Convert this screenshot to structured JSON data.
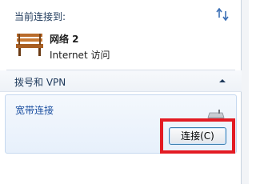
{
  "header": {
    "label": "当前连接到:"
  },
  "network": {
    "name": "网络  2",
    "status": "Internet 访问"
  },
  "group": {
    "label": "拨号和 VPN"
  },
  "connection": {
    "name": "宽带连接",
    "connect_button": "连接(C)"
  },
  "icons": {
    "refresh": "refresh-arrows-icon",
    "network": "bench-icon",
    "collapse": "chevron-up-icon",
    "modem": "modem-icon"
  },
  "colors": {
    "highlight": "#e31b23",
    "link_blue": "#1a4ea0"
  }
}
